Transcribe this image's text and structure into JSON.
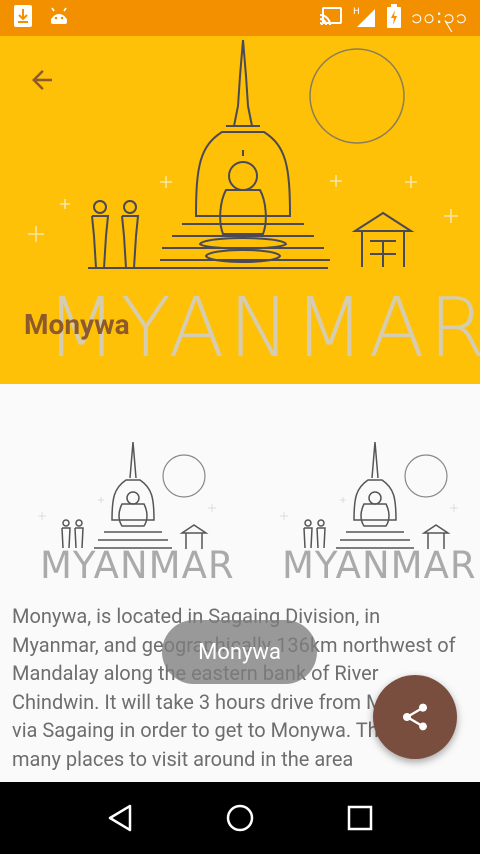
{
  "status_bar": {
    "time": "၁၀:၃၁",
    "icons": [
      "download-icon",
      "android-icon",
      "cast-icon",
      "signal-icon",
      "battery-charging-icon"
    ]
  },
  "header": {
    "title": "Monywa",
    "back_icon": "arrow-back-icon",
    "image_text": "MYANMAR",
    "bg_color": "#ffc107"
  },
  "gallery": {
    "images": [
      {
        "text": "MYANMAR"
      },
      {
        "text": "MYANMAR"
      }
    ]
  },
  "description": "Monywa, is located in Sagaing Division, in Myanmar, and geographically 136km northwest of Mandalay along the eastern bank of River Chindwin. It will take 3 hours drive from Mandalay via Sagaing in order to get to Monywa. There are many places to visit around in the area",
  "toast": {
    "text": "Monywa"
  },
  "fab": {
    "icon": "share-icon",
    "color": "#7a4e3f"
  },
  "nav_bar": {
    "buttons": [
      "back-nav-icon",
      "home-nav-icon",
      "recents-nav-icon"
    ]
  }
}
